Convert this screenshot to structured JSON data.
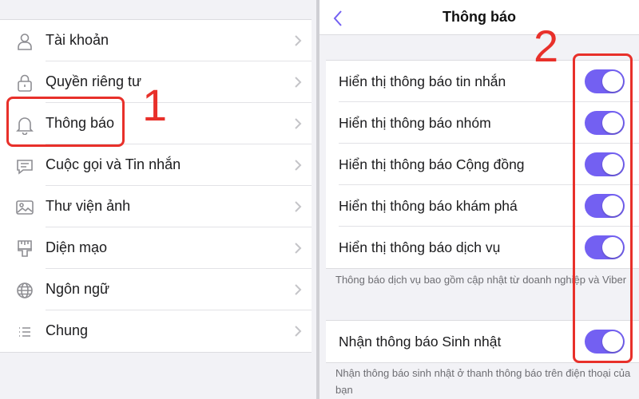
{
  "left_menu": {
    "items": [
      {
        "label": "Tài khoản",
        "icon": "person-icon"
      },
      {
        "label": "Quyền riêng tư",
        "icon": "lock-icon"
      },
      {
        "label": "Thông báo",
        "icon": "bell-icon"
      },
      {
        "label": "Cuộc gọi và Tin nhắn",
        "icon": "chat-bubble-icon"
      },
      {
        "label": "Thư viện ảnh",
        "icon": "image-icon"
      },
      {
        "label": "Diện mạo",
        "icon": "paintbrush-icon"
      },
      {
        "label": "Ngôn ngữ",
        "icon": "globe-icon"
      },
      {
        "label": "Chung",
        "icon": "list-icon"
      }
    ]
  },
  "annotations": {
    "step1": "1",
    "step2": "2",
    "highlight_color": "#e8302a"
  },
  "notifications": {
    "title": "Thông báo",
    "toggles": [
      {
        "label": "Hiển thị thông báo tin nhắn",
        "on": true
      },
      {
        "label": "Hiển thị thông báo nhóm",
        "on": true
      },
      {
        "label": "Hiển thị thông báo Cộng đồng",
        "on": true
      },
      {
        "label": "Hiển thị thông báo khám phá",
        "on": true
      },
      {
        "label": "Hiển thị thông báo dịch vụ",
        "on": true
      }
    ],
    "service_note": "Thông báo dịch vụ bao gồm cập nhật từ doanh nghiệp và Viber",
    "birthday_toggle": {
      "label": "Nhận thông báo Sinh nhật",
      "on": true
    },
    "birthday_note": "Nhận thông báo sinh nhật ở thanh thông báo trên điện thoại của bạn"
  },
  "colors": {
    "toggle_on": "#7360f2",
    "accent": "#7360f2"
  }
}
